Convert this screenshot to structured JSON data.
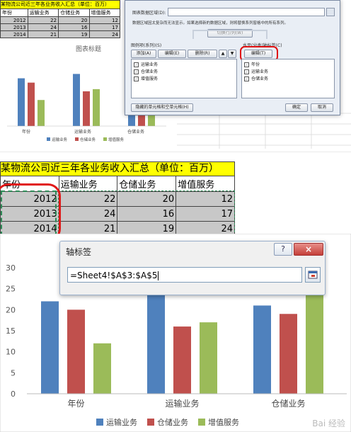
{
  "top_sheet": {
    "title": "某物流公司近三年各业务收入汇总（单位：百万）",
    "headers": [
      "年份",
      "运输业务",
      "仓储业务",
      "增值服务"
    ],
    "rows": [
      [
        "2012",
        "22",
        "20",
        "12"
      ],
      [
        "2013",
        "24",
        "16",
        "17"
      ],
      [
        "2014",
        "21",
        "19",
        "24"
      ]
    ]
  },
  "top_chart": {
    "title": "图表标题",
    "categories": [
      "年份",
      "运输业务",
      "仓储业务"
    ],
    "legend": [
      "运输业务",
      "仓储业务",
      "增值服务"
    ]
  },
  "source_dialog": {
    "range_label": "图表数据区域(D):",
    "info_text_1": "数据区域因太复杂而无法显示。如果选择新的数据区域，则将替换系列窗格中的所有系列。",
    "switch_button": "切换行/列(W)",
    "series_label": "图例项(系列)(S)",
    "add_button": "添加(A)",
    "edit_button": "编辑(E)",
    "delete_button": "删除(R)",
    "series_items": [
      "运输业务",
      "仓储业务",
      "增值服务"
    ],
    "axis_label": "水平(分类)轴标签(C)",
    "axis_edit_button": "编辑(T)",
    "axis_items": [
      "年份",
      "运输业务",
      "仓储业务"
    ],
    "hidden_button": "隐藏的单元格和空单元格(H)",
    "ok_button": "确定",
    "cancel_button": "取消"
  },
  "main_sheet": {
    "title": "某物流公司近三年各业务收入汇总（单位：百万）",
    "headers": [
      "年份",
      "运输业务",
      "仓储业务",
      "增值服务"
    ],
    "rows": [
      [
        "2012",
        "22",
        "20",
        "12"
      ],
      [
        "2013",
        "24",
        "16",
        "17"
      ],
      [
        "2014",
        "21",
        "19",
        "24"
      ]
    ]
  },
  "axis_dialog": {
    "title": "轴标签",
    "help": "?",
    "close": "×",
    "input_value": "=Sheet4!$A$3:$A$5"
  },
  "chart_data": {
    "type": "bar",
    "categories": [
      "年份",
      "运输业务",
      "仓储业务"
    ],
    "series": [
      {
        "name": "运输业务",
        "values": [
          22,
          24,
          21
        ],
        "color": "#4f81bd"
      },
      {
        "name": "仓储业务",
        "values": [
          20,
          16,
          19
        ],
        "color": "#c0504d"
      },
      {
        "name": "增值服务",
        "values": [
          12,
          17,
          24
        ],
        "color": "#9bbb59"
      }
    ],
    "y_ticks": [
      "30",
      "25",
      "20",
      "15",
      "10",
      "5",
      "0"
    ],
    "ylim": [
      0,
      30
    ],
    "legend_position": "bottom"
  },
  "watermark": "Bai 经验"
}
